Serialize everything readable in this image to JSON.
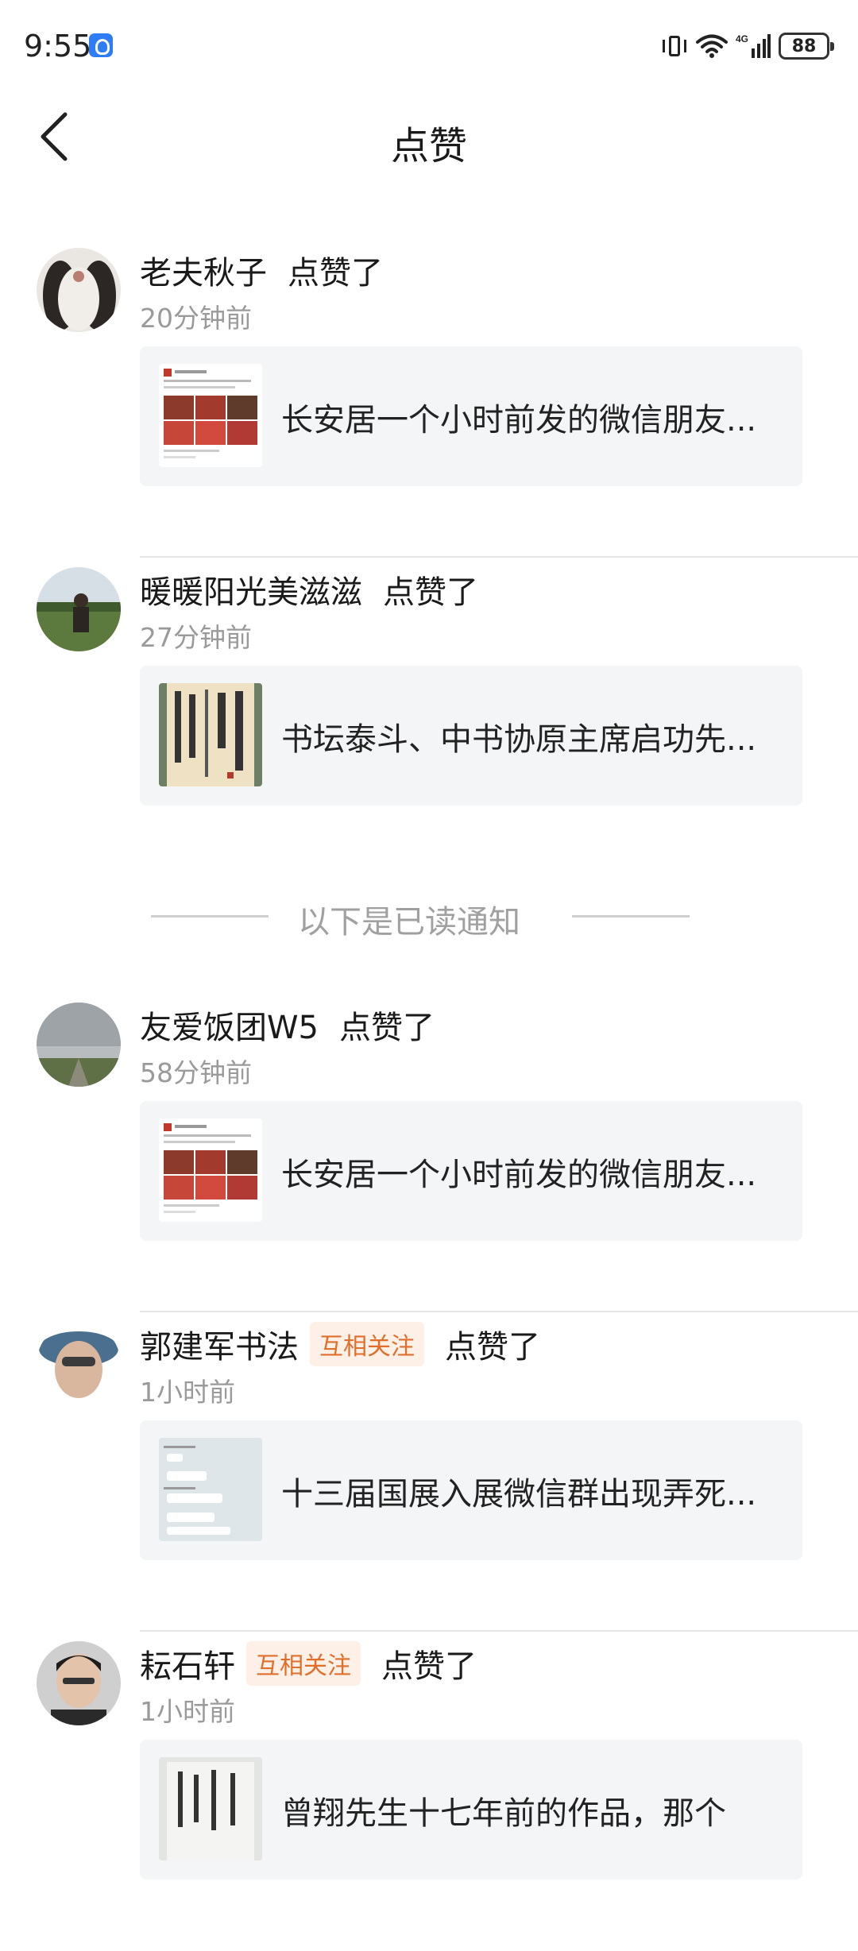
{
  "status_bar": {
    "time": "9:55",
    "battery": "88",
    "network": "4G"
  },
  "header": {
    "title": "点赞"
  },
  "divider_label": "以下是已读通知",
  "notifications": [
    {
      "user": "老夫秋子",
      "mutual": "",
      "action": "点赞了",
      "time": "20分钟前",
      "post_title": "长安居一个小时前发的微信朋友..."
    },
    {
      "user": "暖暖阳光美滋滋",
      "mutual": "",
      "action": "点赞了",
      "time": "27分钟前",
      "post_title": "书坛泰斗、中书协原主席启功先..."
    },
    {
      "user": "友爱饭团W5",
      "mutual": "",
      "action": "点赞了",
      "time": "58分钟前",
      "post_title": "长安居一个小时前发的微信朋友..."
    },
    {
      "user": "郭建军书法",
      "mutual": "互相关注",
      "action": "点赞了",
      "time": "1小时前",
      "post_title": "十三届国展入展微信群出现弄死..."
    },
    {
      "user": "耘石轩",
      "mutual": "互相关注",
      "action": "点赞了",
      "time": "1小时前",
      "post_title": "曾翔先生十七年前的作品，那个"
    }
  ],
  "colors": {
    "accent_orange": "#e06f2c",
    "card_bg": "#f4f5f6",
    "muted_text": "#9a9a9a"
  }
}
